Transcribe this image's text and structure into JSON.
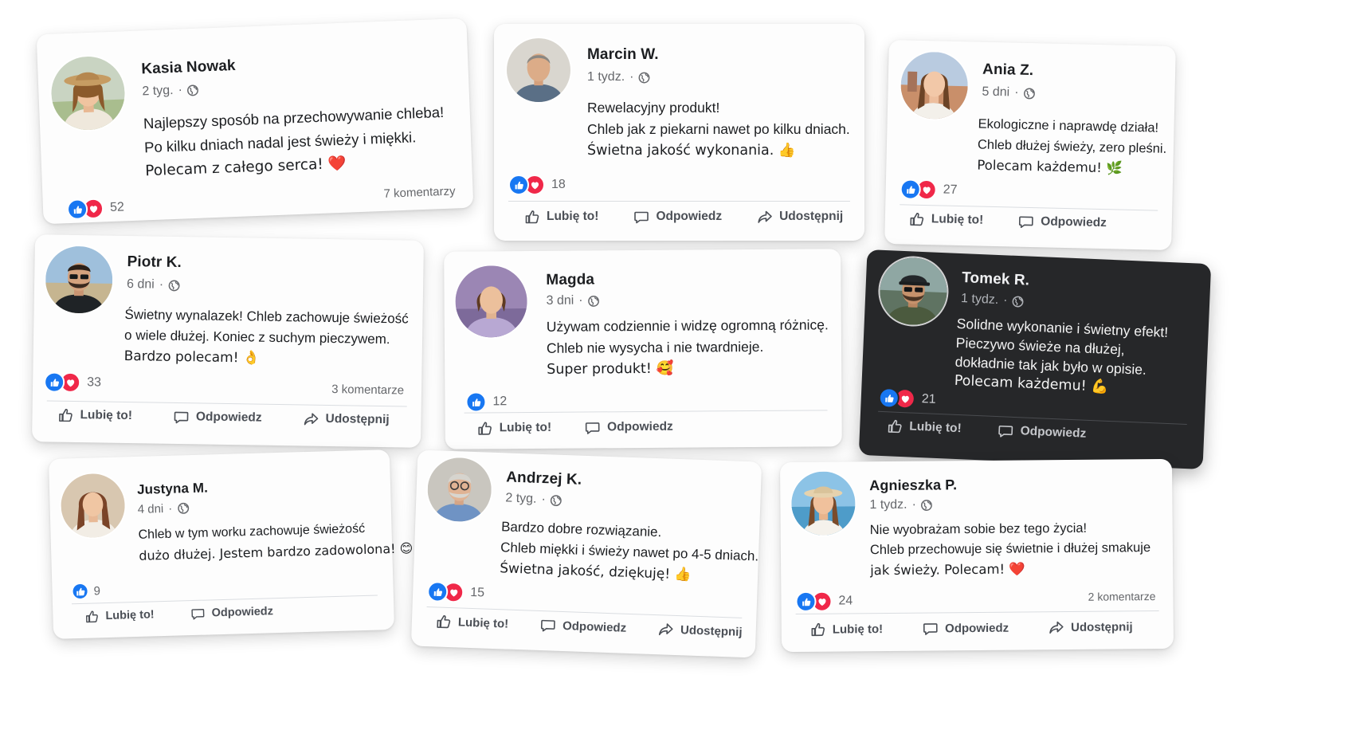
{
  "actions": {
    "like": "Lubię to!",
    "reply": "Odpowiedz",
    "share": "Udostępnij"
  },
  "colors": {
    "like_blue": "#1877f2",
    "love_red": "#f02849",
    "dark_card": "#262729"
  },
  "cards": [
    {
      "name": "Kasia Nowak",
      "time": "2 tyg.",
      "lines": [
        "Najlepszy sposób na przechowywanie chleba!",
        "Po kilku dniach nadal jest świeży i miękki.",
        "Polecam z całego serca! ❤️"
      ],
      "reactions": 52,
      "comments": "7 komentarzy"
    },
    {
      "name": "Marcin W.",
      "time": "1 tydz.",
      "lines": [
        "Rewelacyjny produkt!",
        "Chleb jak z piekarni nawet po kilku dniach.",
        "Świetna jakość wykonania. 👍"
      ],
      "reactions": 18
    },
    {
      "name": "Ania Z.",
      "time": "5 dni",
      "lines": [
        "Ekologiczne i naprawdę działa!",
        "Chleb dłużej świeży, zero pleśni.",
        "Polecam każdemu! 🌿"
      ],
      "reactions": 27
    },
    {
      "name": "Piotr K.",
      "time": "6 dni",
      "lines": [
        "Świetny wynalazek! Chleb zachowuje świeżość",
        "o wiele dłużej. Koniec z suchym pieczywem.",
        "Bardzo polecam! 👌"
      ],
      "reactions": 33,
      "comments": "3 komentarze"
    },
    {
      "name": "Magda",
      "time": "3 dni",
      "lines": [
        "Używam codziennie i widzę ogromną różnicę.",
        "Chleb nie wysycha i nie twardnieje.",
        "Super produkt! 🥰"
      ],
      "reactions": 12
    },
    {
      "name": "Tomek R.",
      "time": "1 tydz.",
      "lines": [
        "Solidne wykonanie i świetny efekt!",
        "Pieczywo świeże na dłużej,",
        "dokładnie tak jak było w opisie.",
        "Polecam każdemu! 💪"
      ],
      "reactions": 21
    },
    {
      "name": "Justyna M.",
      "time": "4 dni",
      "lines": [
        "Chleb w tym worku zachowuje świeżość",
        "dużo dłużej. Jestem bardzo zadowolona! 😊"
      ],
      "reactions": 9
    },
    {
      "name": "Andrzej K.",
      "time": "2 tyg.",
      "lines": [
        "Bardzo dobre rozwiązanie.",
        "Chleb miękki i świeży nawet po 4-5 dniach.",
        "Świetna jakość, dziękuję! 👍"
      ],
      "reactions": 15
    },
    {
      "name": "Agnieszka P.",
      "time": "1 tydz.",
      "lines": [
        "Nie wyobrażam sobie bez tego życia!",
        "Chleb przechowuje się świetnie i dłużej smakuje",
        "jak świeży. Polecam! ❤️"
      ],
      "reactions": 24,
      "comments": "2 komentarze"
    }
  ]
}
